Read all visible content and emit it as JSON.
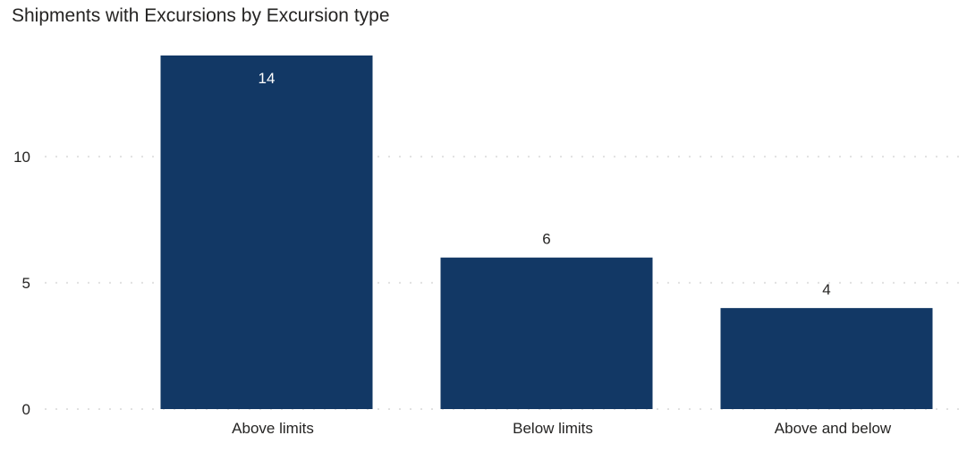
{
  "chart_data": {
    "type": "bar",
    "title": "Shipments with Excursions by Excursion type",
    "categories": [
      "Above limits",
      "Below limits",
      "Above and below"
    ],
    "values": [
      14,
      6,
      4
    ],
    "data_labels": [
      "14",
      "6",
      "4"
    ],
    "xlabel": "",
    "ylabel": "",
    "ylim": [
      0,
      14
    ],
    "yticks": [
      0,
      5,
      10
    ],
    "ytick_labels": [
      "0",
      "5",
      "10"
    ],
    "grid": "horizontal-dotted",
    "legend": "none",
    "colors": {
      "bar": "#123865",
      "label_inside": "#ffffff",
      "label_outside": "#252423",
      "grid": "#e1e1e1"
    }
  }
}
